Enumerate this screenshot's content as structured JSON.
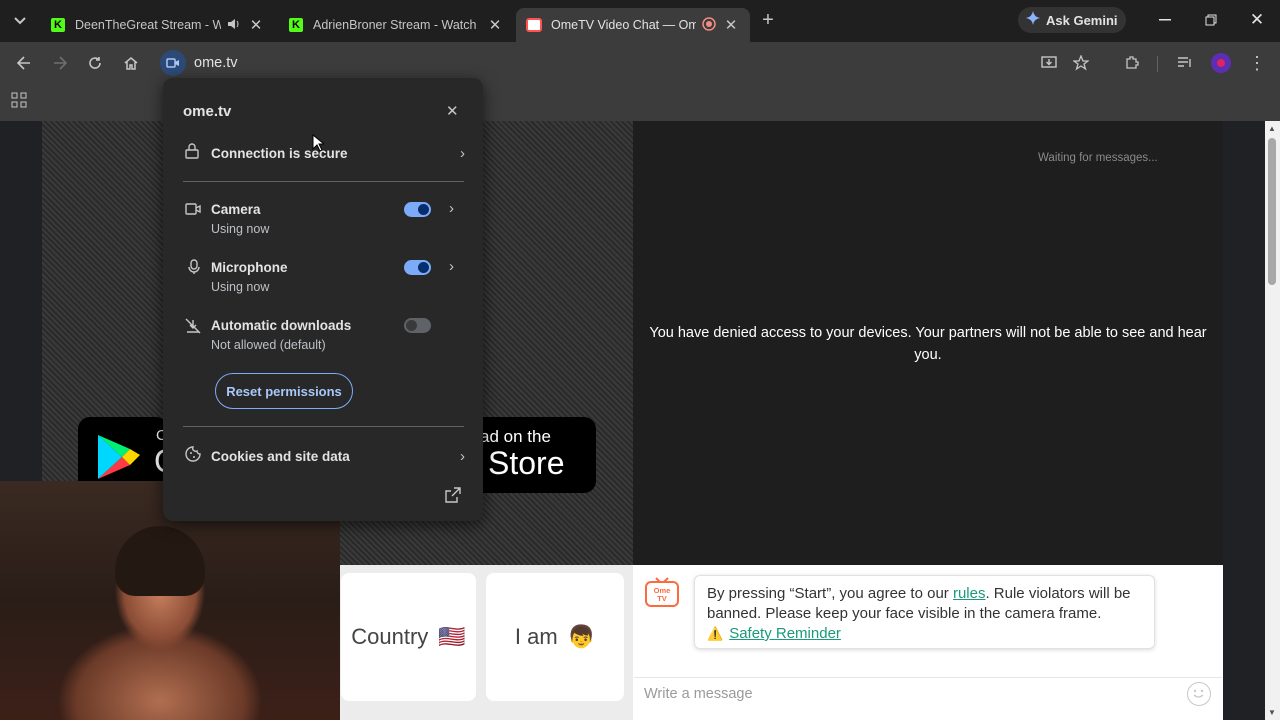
{
  "tabs": [
    {
      "title": "DeenTheGreat Stream - Wa",
      "icon": "kick-icon",
      "audio": true
    },
    {
      "title": "AdrienBroner Stream - Watch L",
      "icon": "kick-icon"
    },
    {
      "title": "OmeTV Video Chat — Ome",
      "icon": "ometv-icon",
      "active": true,
      "recording": true
    }
  ],
  "gemini_label": "Ask Gemini",
  "url": "ome.tv",
  "page": {
    "waiting": "Waiting for messages...",
    "denied": "You have denied access to your devices. Your partners will not be able to see and hear you.",
    "apple_store_top": "ad on the",
    "apple_store_big": "Store",
    "google_partial_top": "C",
    "google_partial_big": "C",
    "country_label": "Country",
    "country_flag": "🇺🇸",
    "iam_label": "I am",
    "iam_emoji": "👦",
    "notice_part1": "By pressing “Start”, you agree to our ",
    "notice_link": "rules",
    "notice_part2": ". Rule violators will be banned. Please keep your face visible in the camera frame.",
    "safety_icon": "⚠️",
    "safety_link": "Safety Reminder",
    "message_placeholder": "Write a message",
    "logo_text": "Ome TV"
  },
  "popup": {
    "site": "ome.tv",
    "connection": "Connection is secure",
    "camera_label": "Camera",
    "camera_status": "Using now",
    "camera_on": true,
    "mic_label": "Microphone",
    "mic_status": "Using now",
    "mic_on": true,
    "downloads_label": "Automatic downloads",
    "downloads_status": "Not allowed (default)",
    "downloads_on": false,
    "reset_label": "Reset permissions",
    "cookies_label": "Cookies and site data"
  },
  "colors": {
    "accent": "#7cacf8",
    "kick": "#53fc18",
    "link": "#1a9a7a"
  }
}
